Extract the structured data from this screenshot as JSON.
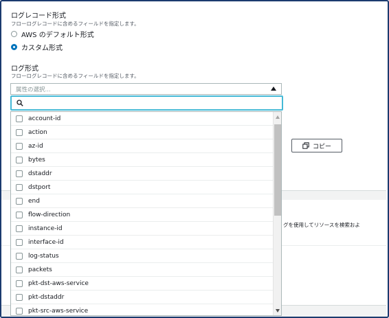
{
  "log_record_format": {
    "title": "ログレコード形式",
    "description": "フローログレコードに含めるフィールドを指定します。",
    "options": [
      {
        "label": "AWS のデフォルト形式",
        "selected": false
      },
      {
        "label": "カスタム形式",
        "selected": true
      }
    ]
  },
  "log_format": {
    "title": "ログ形式",
    "description": "フローログレコードに含めるフィールドを指定します。",
    "select_placeholder": "属性の選択...",
    "search_value": "",
    "items": [
      {
        "label": "account-id"
      },
      {
        "label": "action"
      },
      {
        "label": "az-id"
      },
      {
        "label": "bytes"
      },
      {
        "label": "dstaddr"
      },
      {
        "label": "dstport"
      },
      {
        "label": "end"
      },
      {
        "label": "flow-direction"
      },
      {
        "label": "instance-id"
      },
      {
        "label": "interface-id"
      },
      {
        "label": "log-status"
      },
      {
        "label": "packets"
      },
      {
        "label": "pkt-dst-aws-service"
      },
      {
        "label": "pkt-dstaddr"
      },
      {
        "label": "pkt-src-aws-service"
      }
    ]
  },
  "copy_button": {
    "label": "コピー"
  },
  "background_text": "グを使用してリソースを検索およ",
  "colors": {
    "accent": "#0073bb",
    "focus": "#44b9d6",
    "frame": "#1b3a6e"
  }
}
